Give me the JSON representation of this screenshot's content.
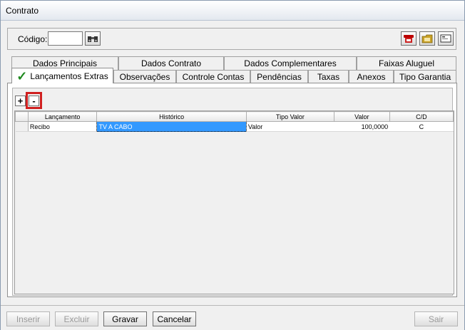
{
  "window": {
    "title": "Contrato"
  },
  "header": {
    "codigo_label": "Código:",
    "codigo_value": "",
    "tool_icons": [
      "binoculars-icon",
      "phone-icon",
      "folder-icon",
      "card-icon"
    ]
  },
  "tabs": {
    "row1": [
      "Dados Principais",
      "Dados Contrato",
      "Dados Complementares",
      "Faixas Aluguel"
    ],
    "row2": [
      "Lançamentos Extras",
      "Observações",
      "Controle Contas",
      "Pendências",
      "Taxas",
      "Anexos",
      "Tipo Garantia"
    ],
    "active": "Lançamentos Extras"
  },
  "grid": {
    "add_label": "+",
    "remove_label": "-",
    "columns": [
      "Lançamento",
      "Histórico",
      "Tipo Valor",
      "Valor",
      "C/D"
    ],
    "rows": [
      {
        "lancamento": "Recibo",
        "historico": "TV A CABO",
        "tipo_valor": "Valor",
        "valor": "100,0000",
        "cd": "C"
      }
    ]
  },
  "buttons": {
    "inserir": "Inserir",
    "excluir": "Excluir",
    "gravar": "Gravar",
    "cancelar": "Cancelar",
    "sair": "Sair"
  },
  "colors": {
    "selection": "#3399ff",
    "check": "#1f8a1f",
    "highlight": "#d02020"
  }
}
